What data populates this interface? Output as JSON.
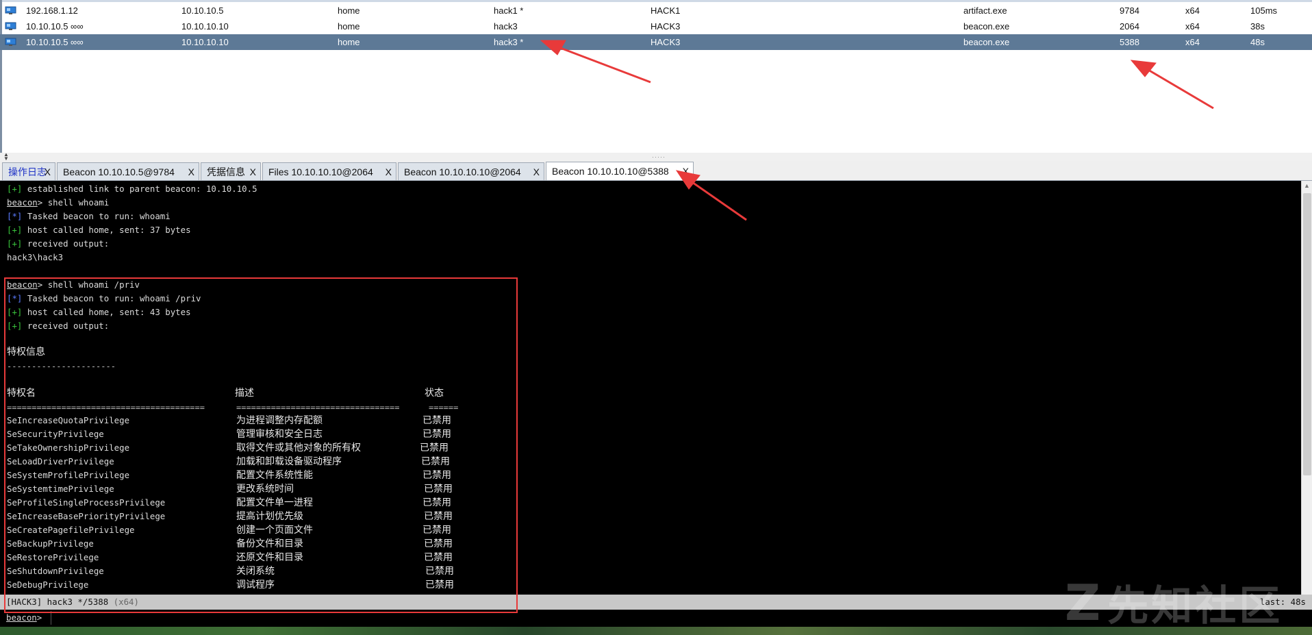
{
  "sessions": [
    {
      "external": "192.168.1.12",
      "internal": "10.10.10.5",
      "listener": "home",
      "user": "hack1 *",
      "computer": "HACK1",
      "process": "artifact.exe",
      "pid": "9784",
      "arch": "x64",
      "last": "105ms",
      "selected": false
    },
    {
      "external": "10.10.10.5 ∞∞",
      "internal": "10.10.10.10",
      "listener": "home",
      "user": "hack3",
      "computer": "HACK3",
      "process": "beacon.exe",
      "pid": "2064",
      "arch": "x64",
      "last": "38s",
      "selected": false
    },
    {
      "external": "10.10.10.5 ∞∞",
      "internal": "10.10.10.10",
      "listener": "home",
      "user": "hack3 *",
      "computer": "HACK3",
      "process": "beacon.exe",
      "pid": "5388",
      "arch": "x64",
      "last": "48s",
      "selected": true
    }
  ],
  "tabs": [
    {
      "label": "操作日志",
      "close": "X"
    },
    {
      "label": "Beacon 10.10.10.5@9784",
      "close": "X"
    },
    {
      "label": "凭据信息",
      "close": "X"
    },
    {
      "label": "Files 10.10.10.10@2064",
      "close": "X"
    },
    {
      "label": "Beacon 10.10.10.10@2064",
      "close": "X"
    },
    {
      "label": "Beacon 10.10.10.10@5388",
      "close": "X"
    }
  ],
  "console": {
    "l1_tag": "[+]",
    "l1_text": " established link to parent beacon: 10.10.10.5",
    "prompt": "beacon",
    "prompt_sep": ">",
    "cmd1": " shell whoami",
    "l3_tag": "[*]",
    "l3_text": " Tasked beacon to run: whoami",
    "l4_tag": "[+]",
    "l4_text": " host called home, sent: 37 bytes",
    "l5_tag": "[+]",
    "l5_text": " received output:",
    "whoami_out": "hack3\\hack3",
    "cmd2": " shell whoami /priv",
    "l8_tag": "[*]",
    "l8_text": " Tasked beacon to run: whoami /priv",
    "l9_tag": "[+]",
    "l9_text": " host called home, sent: 43 bytes",
    "l10_tag": "[+]",
    "l10_text": " received output:",
    "priv_title": "特权信息",
    "priv_dashes": "----------------------",
    "col_name": "特权名",
    "col_desc": "描述",
    "col_state": "状态",
    "sep_name": "========================================",
    "sep_desc": "=================================",
    "sep_state": "======",
    "privileges": [
      {
        "name": "SeIncreaseQuotaPrivilege",
        "desc": "为进程调整内存配额",
        "state": "已禁用"
      },
      {
        "name": "SeSecurityPrivilege",
        "desc": "管理审核和安全日志",
        "state": "已禁用"
      },
      {
        "name": "SeTakeOwnershipPrivilege",
        "desc": "取得文件或其他对象的所有权",
        "state": "已禁用"
      },
      {
        "name": "SeLoadDriverPrivilege",
        "desc": "加载和卸载设备驱动程序",
        "state": "已禁用"
      },
      {
        "name": "SeSystemProfilePrivilege",
        "desc": "配置文件系统性能",
        "state": "已禁用"
      },
      {
        "name": "SeSystemtimePrivilege",
        "desc": "更改系统时间",
        "state": "已禁用"
      },
      {
        "name": "SeProfileSingleProcessPrivilege",
        "desc": "配置文件单一进程",
        "state": "已禁用"
      },
      {
        "name": "SeIncreaseBasePriorityPrivilege",
        "desc": "提高计划优先级",
        "state": "已禁用"
      },
      {
        "name": "SeCreatePagefilePrivilege",
        "desc": "创建一个页面文件",
        "state": "已禁用"
      },
      {
        "name": "SeBackupPrivilege",
        "desc": "备份文件和目录",
        "state": "已禁用"
      },
      {
        "name": "SeRestorePrivilege",
        "desc": "还原文件和目录",
        "state": "已禁用"
      },
      {
        "name": "SeShutdownPrivilege",
        "desc": "关闭系统",
        "state": "已禁用"
      },
      {
        "name": "SeDebugPrivilege",
        "desc": "调试程序",
        "state": "已禁用"
      }
    ]
  },
  "status": {
    "left": "[HACK3] hack3 */5388",
    "arch": "(x64)",
    "right": "last: 48s"
  },
  "input": {
    "prompt": "beacon",
    "sep": ">"
  },
  "watermark": "先知社区",
  "colors": {
    "selected_row": "#5d7996",
    "highlight": "#e83a3a",
    "tag_green": "#39c43c",
    "tag_blue": "#5b7bff"
  }
}
